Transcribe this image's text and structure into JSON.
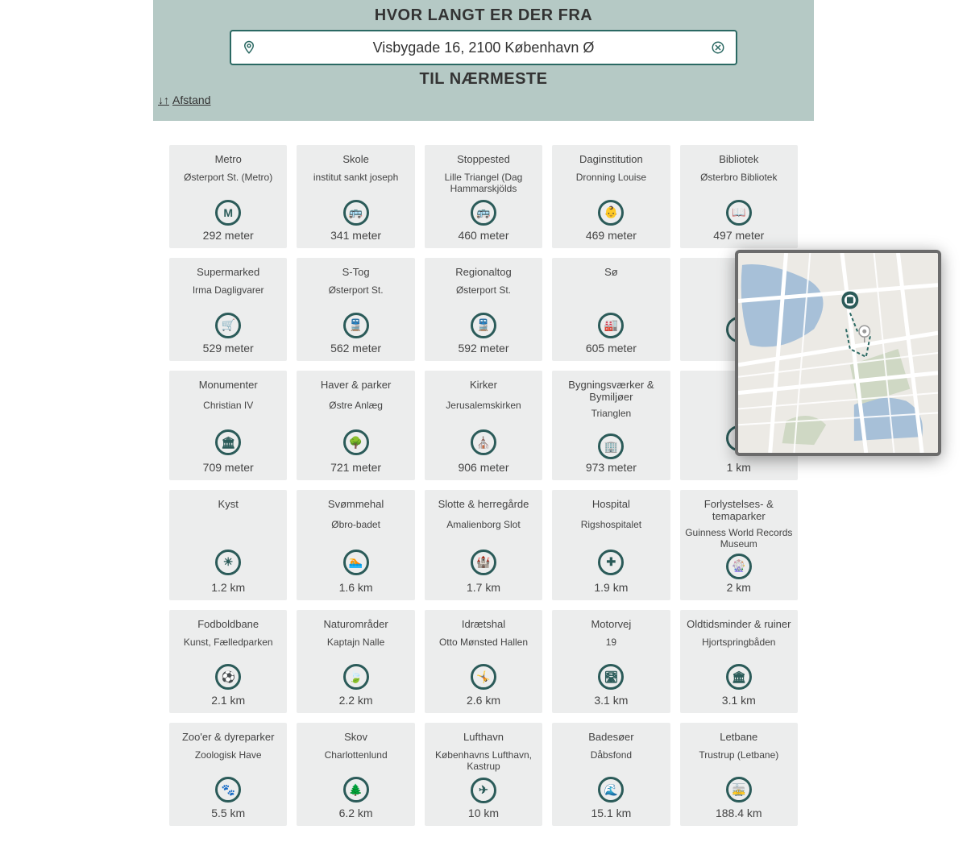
{
  "header": {
    "title": "HVOR LANGT ER DER FRA",
    "subtitle": "TIL NÆRMESTE"
  },
  "search": {
    "value": "Visbygade 16, 2100 København Ø",
    "placeholder": ""
  },
  "sort": {
    "label": "Afstand",
    "icon": "↓↑"
  },
  "colors": {
    "accent": "#2b6963",
    "headerBg": "#b5c9c5",
    "cardBg": "#eceded"
  },
  "cards": [
    {
      "category": "Metro",
      "name": "Østerport St. (Metro)",
      "distance": "292 meter",
      "icon": "M"
    },
    {
      "category": "Skole",
      "name": "institut sankt joseph",
      "distance": "341 meter",
      "icon": "🚌"
    },
    {
      "category": "Stoppested",
      "name": "Lille Triangel (Dag Hammarskjölds",
      "distance": "460 meter",
      "icon": "🚌"
    },
    {
      "category": "Daginstitution",
      "name": "Dronning Louise",
      "distance": "469 meter",
      "icon": "👶"
    },
    {
      "category": "Bibliotek",
      "name": "Østerbro Bibliotek",
      "distance": "497 meter",
      "icon": "📖"
    },
    {
      "category": "Supermarked",
      "name": "Irma Dagligvarer",
      "distance": "529 meter",
      "icon": "🛒"
    },
    {
      "category": "S-Tog",
      "name": "Østerport St.",
      "distance": "562 meter",
      "icon": "🚆"
    },
    {
      "category": "Regionaltog",
      "name": "Østerport St.",
      "distance": "592 meter",
      "icon": "🚆"
    },
    {
      "category": "Sø",
      "name": "",
      "distance": "605 meter",
      "icon": "🏭"
    },
    {
      "category": "",
      "name": "",
      "distance": "",
      "icon": ""
    },
    {
      "category": "Monumenter",
      "name": "Christian IV",
      "distance": "709 meter",
      "icon": "🏛"
    },
    {
      "category": "Haver & parker",
      "name": "Østre Anlæg",
      "distance": "721 meter",
      "icon": "🌳"
    },
    {
      "category": "Kirker",
      "name": "Jerusalemskirken",
      "distance": "906 meter",
      "icon": "⛪"
    },
    {
      "category": "Bygningsværker & Bymiljøer",
      "name": "Trianglen",
      "distance": "973 meter",
      "icon": "🏢"
    },
    {
      "category": "",
      "name": "",
      "distance": "1 km",
      "icon": ""
    },
    {
      "category": "Kyst",
      "name": "",
      "distance": "1.2 km",
      "icon": "☀"
    },
    {
      "category": "Svømmehal",
      "name": "Øbro-badet",
      "distance": "1.6 km",
      "icon": "🏊"
    },
    {
      "category": "Slotte & herregårde",
      "name": "Amalienborg Slot",
      "distance": "1.7 km",
      "icon": "🏰"
    },
    {
      "category": "Hospital",
      "name": "Rigshospitalet",
      "distance": "1.9 km",
      "icon": "✚"
    },
    {
      "category": "Forlystelses- & temaparker",
      "name": "Guinness World Records Museum",
      "distance": "2 km",
      "icon": "🎡"
    },
    {
      "category": "Fodboldbane",
      "name": "Kunst, Fælledparken",
      "distance": "2.1 km",
      "icon": "⚽"
    },
    {
      "category": "Naturområder",
      "name": "Kaptajn Nalle",
      "distance": "2.2 km",
      "icon": "🍃"
    },
    {
      "category": "Idrætshal",
      "name": "Otto Mønsted Hallen",
      "distance": "2.6 km",
      "icon": "🤸"
    },
    {
      "category": "Motorvej",
      "name": "19",
      "distance": "3.1 km",
      "icon": "🛣"
    },
    {
      "category": "Oldtidsminder & ruiner",
      "name": "Hjortspringbåden",
      "distance": "3.1 km",
      "icon": "🏛"
    },
    {
      "category": "Zoo'er & dyreparker",
      "name": "Zoologisk Have",
      "distance": "5.5 km",
      "icon": "🐾"
    },
    {
      "category": "Skov",
      "name": "Charlottenlund",
      "distance": "6.2 km",
      "icon": "🌲"
    },
    {
      "category": "Lufthavn",
      "name": "Københavns Lufthavn, Kastrup",
      "distance": "10 km",
      "icon": "✈"
    },
    {
      "category": "Badesøer",
      "name": "Dåbsfond",
      "distance": "15.1 km",
      "icon": "🌊"
    },
    {
      "category": "Letbane",
      "name": "Trustrup (Letbane)",
      "distance": "188.4 km",
      "icon": "🚋"
    }
  ],
  "map": {
    "markerLabel": "location-marker",
    "secondaryMarker": "poi-marker"
  }
}
